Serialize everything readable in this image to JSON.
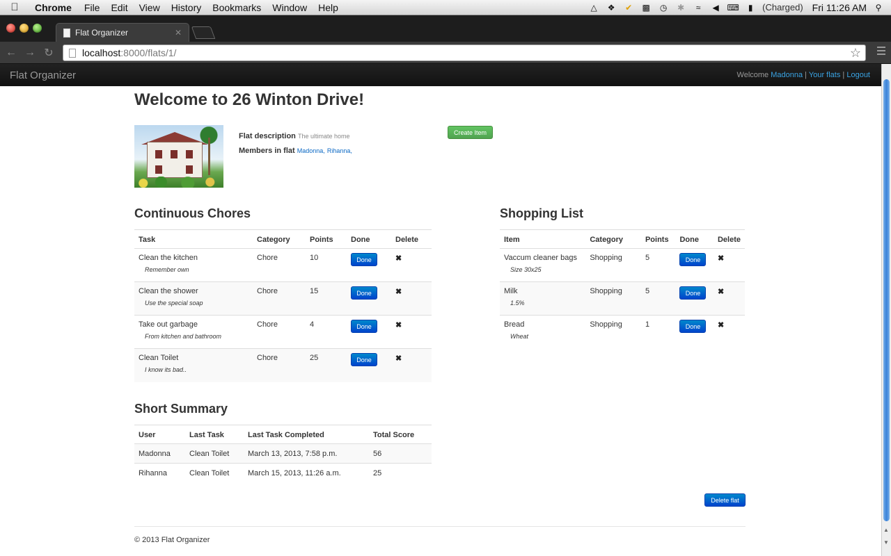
{
  "menubar": {
    "app": "Chrome",
    "items": [
      "File",
      "Edit",
      "View",
      "History",
      "Bookmarks",
      "Window",
      "Help"
    ],
    "battery_status": "(Charged)",
    "clock": "Fri 11:26 AM"
  },
  "browser": {
    "tab_title": "Flat Organizer",
    "url_host": "localhost",
    "url_rest": ":8000/flats/1/"
  },
  "site_nav": {
    "brand": "Flat Organizer",
    "welcome": "Welcome",
    "user": "Madonna",
    "your_flats": "Your flats",
    "logout": "Logout",
    "separator": "|"
  },
  "flat": {
    "title": "Welcome to 26 Winton Drive!",
    "description_label": "Flat description",
    "description": "The ultimate home",
    "members_label": "Members in flat",
    "members": [
      "Madonna,",
      "Rihanna,"
    ],
    "create_item_label": "Create Item"
  },
  "chores": {
    "title": "Continuous Chores",
    "columns": [
      "Task",
      "Category",
      "Points",
      "Done",
      "Delete"
    ],
    "rows": [
      {
        "task": "Clean the kitchen",
        "note": "Remember own",
        "category": "Chore",
        "points": "10",
        "done": "Done"
      },
      {
        "task": "Clean the shower",
        "note": "Use the special soap",
        "category": "Chore",
        "points": "15",
        "done": "Done"
      },
      {
        "task": "Take out garbage",
        "note": "From kitchen and bathroom",
        "category": "Chore",
        "points": "4",
        "done": "Done"
      },
      {
        "task": "Clean Toilet",
        "note": "I know its bad..",
        "category": "Chore",
        "points": "25",
        "done": "Done"
      }
    ]
  },
  "shopping": {
    "title": "Shopping List",
    "columns": [
      "Item",
      "Category",
      "Points",
      "Done",
      "Delete"
    ],
    "rows": [
      {
        "task": "Vaccum cleaner bags",
        "note": "Size 30x25",
        "category": "Shopping",
        "points": "5",
        "done": "Done"
      },
      {
        "task": "Milk",
        "note": "1.5%",
        "category": "Shopping",
        "points": "5",
        "done": "Done"
      },
      {
        "task": "Bread",
        "note": "Wheat",
        "category": "Shopping",
        "points": "1",
        "done": "Done"
      }
    ]
  },
  "summary": {
    "title": "Short Summary",
    "columns": [
      "User",
      "Last Task",
      "Last Task Completed",
      "Total Score"
    ],
    "rows": [
      {
        "user": "Madonna",
        "last_task": "Clean Toilet",
        "completed": "March 13, 2013, 7:58 p.m.",
        "score": "56"
      },
      {
        "user": "Rihanna",
        "last_task": "Clean Toilet",
        "completed": "March 15, 2013, 11:26 a.m.",
        "score": "25"
      }
    ]
  },
  "delete_flat_label": "Delete flat",
  "footer": "© 2013 Flat Organizer",
  "colors": {
    "primary_button": "#0055cc",
    "success_button": "#51a351",
    "navbar": "#1b1b1b",
    "link": "#3aa3e3"
  }
}
